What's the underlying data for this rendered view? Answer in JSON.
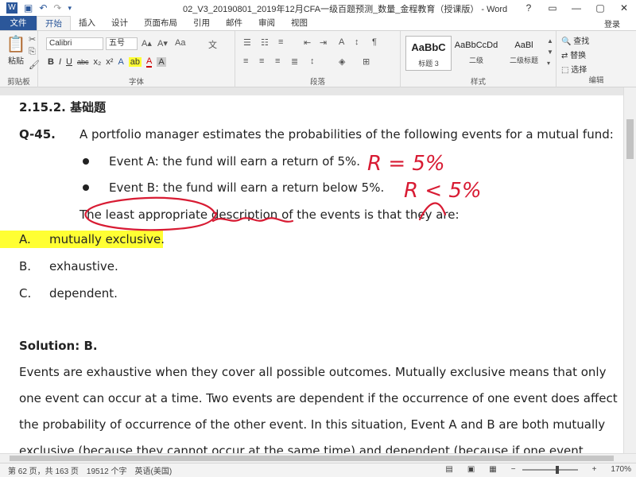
{
  "window": {
    "title": "02_V3_20190801_2019年12月CFA一级百题预测_数量_金程教育（授课版） - Word",
    "controls": {
      "help": "?",
      "ribbon_display": "▭",
      "minimize": "—",
      "restore": "▢",
      "close": "✕"
    }
  },
  "tabs": [
    {
      "label": "文件"
    },
    {
      "label": "开始"
    },
    {
      "label": "插入"
    },
    {
      "label": "设计"
    },
    {
      "label": "页面布局"
    },
    {
      "label": "引用"
    },
    {
      "label": "邮件"
    },
    {
      "label": "审阅"
    },
    {
      "label": "视图"
    }
  ],
  "login_label": "登录",
  "ribbon": {
    "clipboard": {
      "paste": "粘贴",
      "group": "剪贴板"
    },
    "font": {
      "name": "Calibri",
      "size": "五号",
      "group": "字体",
      "bold": "B",
      "italic": "I",
      "underline": "U",
      "strike": "abc",
      "sub": "x₂",
      "sup": "x²",
      "grow": "A▴",
      "shrink": "A▾",
      "clear": "Aa",
      "wen": "文"
    },
    "paragraph": {
      "group": "段落"
    },
    "styles": {
      "group": "样式",
      "items": [
        {
          "sample": "AaBbC",
          "name": "标题 3"
        },
        {
          "sample": "AaBbCcDd",
          "name": "二级"
        },
        {
          "sample": "AaBl",
          "name": "二级标题"
        }
      ]
    },
    "editing": {
      "group": "编辑",
      "find": "查找",
      "replace": "替换",
      "select": "选择"
    }
  },
  "document": {
    "heading": "2.15.2. 基础题",
    "question_label": "Q-45.",
    "question_text": "A portfolio manager estimates the probabilities of the following events for a mutual fund:",
    "events": [
      "Event A: the fund will earn a return of 5%.",
      "Event B: the fund will earn a return below 5%."
    ],
    "stem": "The least appropriate description of the events is that they are:",
    "options": [
      {
        "label": "A.",
        "text": "mutually exclusive."
      },
      {
        "label": "B.",
        "text": "exhaustive."
      },
      {
        "label": "C.",
        "text": "dependent."
      }
    ],
    "solution_label": "Solution: B.",
    "solution_lines": [
      "Events are exhaustive when they cover all possible outcomes. Mutually exclusive means that only",
      "one event can occur at a time. Two events are dependent if the occurrence of one event does affect",
      "the probability of occurrence of the other event. In this situation, Event A and B are both mutually",
      "exclusive (because they cannot occur at the same time) and dependent (because if one event"
    ],
    "annotations": {
      "note_a": "R = 5%",
      "note_b": "R < 5%"
    }
  },
  "status": {
    "page": "第 62 页，共 163 页",
    "words": "19512 个字",
    "language": "英语(美国)",
    "zoom": "170%",
    "zoom_level": 0.6
  },
  "colors": {
    "brand": "#2b579a",
    "annotation": "#d81b33",
    "highlight": "#ffff33"
  }
}
